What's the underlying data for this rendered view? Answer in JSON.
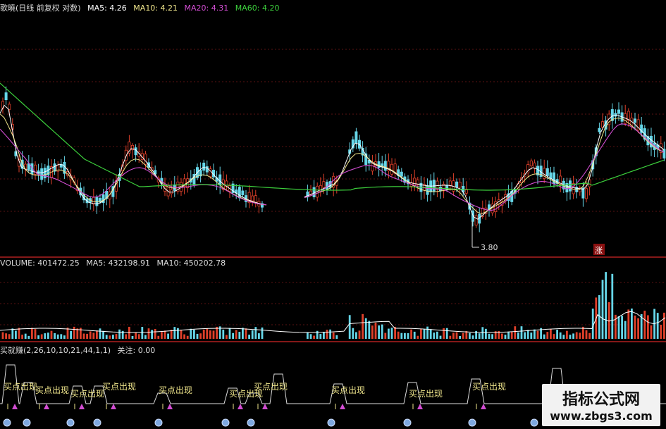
{
  "header": {
    "title": "歌曉(日线 前复权 对数)",
    "ma": [
      {
        "label": "MA5: 4.26",
        "color": "#ffffff"
      },
      {
        "label": "MA10: 4.21",
        "color": "#f0e68c"
      },
      {
        "label": "MA20: 4.31",
        "color": "#d24dd2"
      },
      {
        "label": "MA60: 4.20",
        "color": "#3ccf3c"
      }
    ]
  },
  "price_panel": {
    "low_marker": "3.80",
    "badge": "涨"
  },
  "volume_panel": {
    "items": [
      {
        "label": "VOLUME: 401472.25",
        "color": "#dddddd"
      },
      {
        "label": "MA5: 432198.91",
        "color": "#dddddd"
      },
      {
        "label": "MA10: 450202.78",
        "color": "#dddddd"
      }
    ]
  },
  "indicator_panel": {
    "label": "买就赚(2,26,10,10,21,44,1,1)",
    "focus": "关注: 0.00",
    "signal_text": "买点出现"
  },
  "watermark": {
    "line1": "指标公式网",
    "line2": "www.zbgs3.com"
  },
  "colors": {
    "up": "#e0402a",
    "down": "#66d6e8",
    "grid": "#5a1212",
    "separator": "#b02020",
    "ma5": "#ffffff",
    "ma10": "#f0e68c",
    "ma20": "#d24dd2",
    "ma60": "#3ccf3c"
  }
}
